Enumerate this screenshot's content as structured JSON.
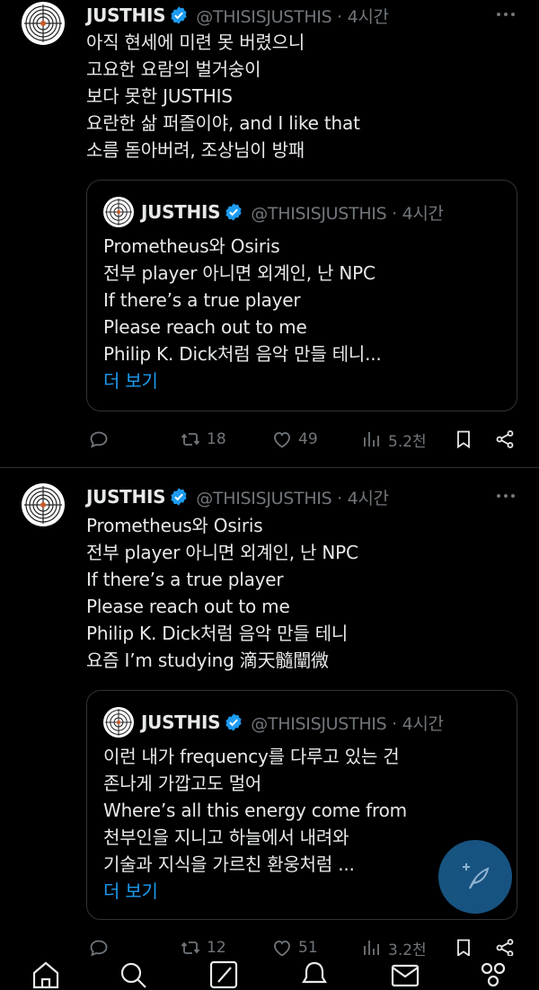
{
  "tweets": [
    {
      "name": "JUSTHIS",
      "handle": "@THISISJUSTHIS · 4시간",
      "lines": [
        "아직 현세에 미련 못 버렸으니",
        "고요한 요람의 벌거숭이",
        "보다 못한 JUSTHIS",
        "요란한 삶 퍼즐이야, and I like that",
        "소름 돋아버려, 조상님이 방패"
      ],
      "quote": {
        "name": "JUSTHIS",
        "handle": "@THISISJUSTHIS · 4시간",
        "lines": [
          "Prometheus와 Osiris",
          "전부 player 아니면 외계인, 난 NPC",
          "If there’s a true player",
          "Please reach out to me",
          "Philip K. Dick처럼 음악 만들 테니..."
        ],
        "more": "더 보기"
      },
      "actions": {
        "retweets": "18",
        "likes": "49",
        "views": "5.2천"
      }
    },
    {
      "name": "JUSTHIS",
      "handle": "@THISISJUSTHIS · 4시간",
      "lines": [
        "Prometheus와 Osiris",
        "전부 player 아니면 외계인, 난 NPC",
        "If there’s a true player",
        "Please reach out to me",
        "Philip K. Dick처럼 음악 만들 테니",
        "요즘 I’m studying 滴天髓闡微"
      ],
      "quote": {
        "name": "JUSTHIS",
        "handle": "@THISISJUSTHIS · 4시간",
        "lines": [
          "이런 내가 frequency를 다루고 있는 건",
          "존나게 가깝고도 멀어",
          "Where’s all this energy come from",
          "천부인을 지니고 하늘에서 내려와",
          "기술과 지식을 가르친 환웅처럼 ..."
        ],
        "more": "더 보기"
      },
      "actions": {
        "retweets": "12",
        "likes": "51",
        "views": "3.2천"
      }
    }
  ],
  "icons": {
    "verified": "verified-badge-icon",
    "reply": "reply-icon",
    "retweet": "retweet-icon",
    "like": "heart-icon",
    "views": "views-icon",
    "bookmark": "bookmark-icon",
    "share": "share-icon",
    "compose": "compose-icon"
  },
  "colors": {
    "accent": "#1d9bf0",
    "muted": "#71767b",
    "text": "#e7e9ea",
    "border": "#2f3336"
  }
}
